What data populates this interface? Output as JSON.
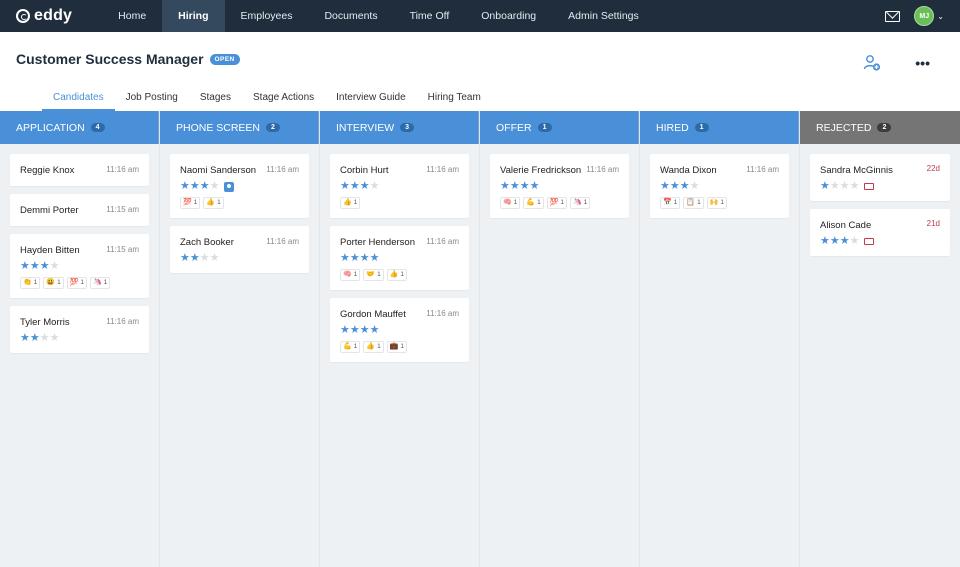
{
  "app": {
    "logo_text": "eddy"
  },
  "nav": {
    "items": [
      {
        "label": "Home",
        "active": false
      },
      {
        "label": "Hiring",
        "active": true
      },
      {
        "label": "Employees",
        "active": false
      },
      {
        "label": "Documents",
        "active": false
      },
      {
        "label": "Time Off",
        "active": false
      },
      {
        "label": "Onboarding",
        "active": false
      },
      {
        "label": "Admin Settings",
        "active": false
      }
    ],
    "user_initials": "MJ"
  },
  "header": {
    "title": "Customer Success Manager",
    "status_badge": "OPEN",
    "more_label": "•••"
  },
  "tabs": [
    {
      "label": "Candidates",
      "active": true
    },
    {
      "label": "Job Posting",
      "active": false
    },
    {
      "label": "Stages",
      "active": false
    },
    {
      "label": "Stage Actions",
      "active": false
    },
    {
      "label": "Interview Guide",
      "active": false
    },
    {
      "label": "Hiring Team",
      "active": false
    }
  ],
  "colors": {
    "accent": "#4a90d9",
    "rejected": "#757575",
    "nav_bg": "#1f2d3d",
    "alert": "#c23b4e"
  },
  "columns": [
    {
      "title": "APPLICATION",
      "count": "4",
      "rejected": false,
      "cards": [
        {
          "name": "Reggie Knox",
          "time": "11:16 am",
          "stars": 0,
          "reactions": []
        },
        {
          "name": "Demmi Porter",
          "time": "11:15 am",
          "stars": 0,
          "reactions": []
        },
        {
          "name": "Hayden Bitten",
          "time": "11:15 am",
          "stars": 3,
          "reactions": [
            {
              "emoji": "👏",
              "count": "1"
            },
            {
              "emoji": "😃",
              "count": "1"
            },
            {
              "emoji": "💯",
              "count": "1"
            },
            {
              "emoji": "🦄",
              "count": "1"
            }
          ]
        },
        {
          "name": "Tyler Morris",
          "time": "11:16 am",
          "stars": 2,
          "reactions": []
        }
      ]
    },
    {
      "title": "PHONE SCREEN",
      "count": "2",
      "rejected": false,
      "cards": [
        {
          "name": "Naomi Sanderson",
          "time": "11:16 am",
          "stars": 3,
          "profile_badge": true,
          "reactions": [
            {
              "emoji": "💯",
              "count": "1"
            },
            {
              "emoji": "👍",
              "count": "1"
            }
          ]
        },
        {
          "name": "Zach Booker",
          "time": "11:16 am",
          "stars": 2,
          "reactions": []
        }
      ]
    },
    {
      "title": "INTERVIEW",
      "count": "3",
      "rejected": false,
      "cards": [
        {
          "name": "Corbin Hurt",
          "time": "11:16 am",
          "stars": 3,
          "reactions": [
            {
              "emoji": "👍",
              "count": "1"
            }
          ]
        },
        {
          "name": "Porter Henderson",
          "time": "11:16 am",
          "stars": 4,
          "reactions": [
            {
              "emoji": "🧠",
              "count": "1"
            },
            {
              "emoji": "🤝",
              "count": "1"
            },
            {
              "emoji": "👍",
              "count": "1"
            }
          ]
        },
        {
          "name": "Gordon Mauffet",
          "time": "11:16 am",
          "stars": 4,
          "reactions": [
            {
              "emoji": "💪",
              "count": "1"
            },
            {
              "emoji": "👍",
              "count": "1"
            },
            {
              "emoji": "💼",
              "count": "1"
            }
          ]
        }
      ]
    },
    {
      "title": "OFFER",
      "count": "1",
      "rejected": false,
      "cards": [
        {
          "name": "Valerie Fredrickson",
          "time": "11:16 am",
          "stars": 4,
          "reactions": [
            {
              "emoji": "🧠",
              "count": "1"
            },
            {
              "emoji": "💪",
              "count": "1"
            },
            {
              "emoji": "💯",
              "count": "1"
            },
            {
              "emoji": "🦄",
              "count": "1"
            }
          ]
        }
      ]
    },
    {
      "title": "HIRED",
      "count": "1",
      "rejected": false,
      "cards": [
        {
          "name": "Wanda Dixon",
          "time": "11:16 am",
          "stars": 3,
          "reactions": [
            {
              "emoji": "📅",
              "count": "1"
            },
            {
              "emoji": "📋",
              "count": "1"
            },
            {
              "emoji": "🙌",
              "count": "1"
            }
          ]
        }
      ]
    },
    {
      "title": "REJECTED",
      "count": "2",
      "rejected": true,
      "cards": [
        {
          "name": "Sandra McGinnis",
          "days": "22d",
          "stars": 1,
          "envelope": true,
          "reactions": []
        },
        {
          "name": "Alison Cade",
          "days": "21d",
          "stars": 3,
          "envelope": true,
          "reactions": []
        }
      ]
    }
  ]
}
